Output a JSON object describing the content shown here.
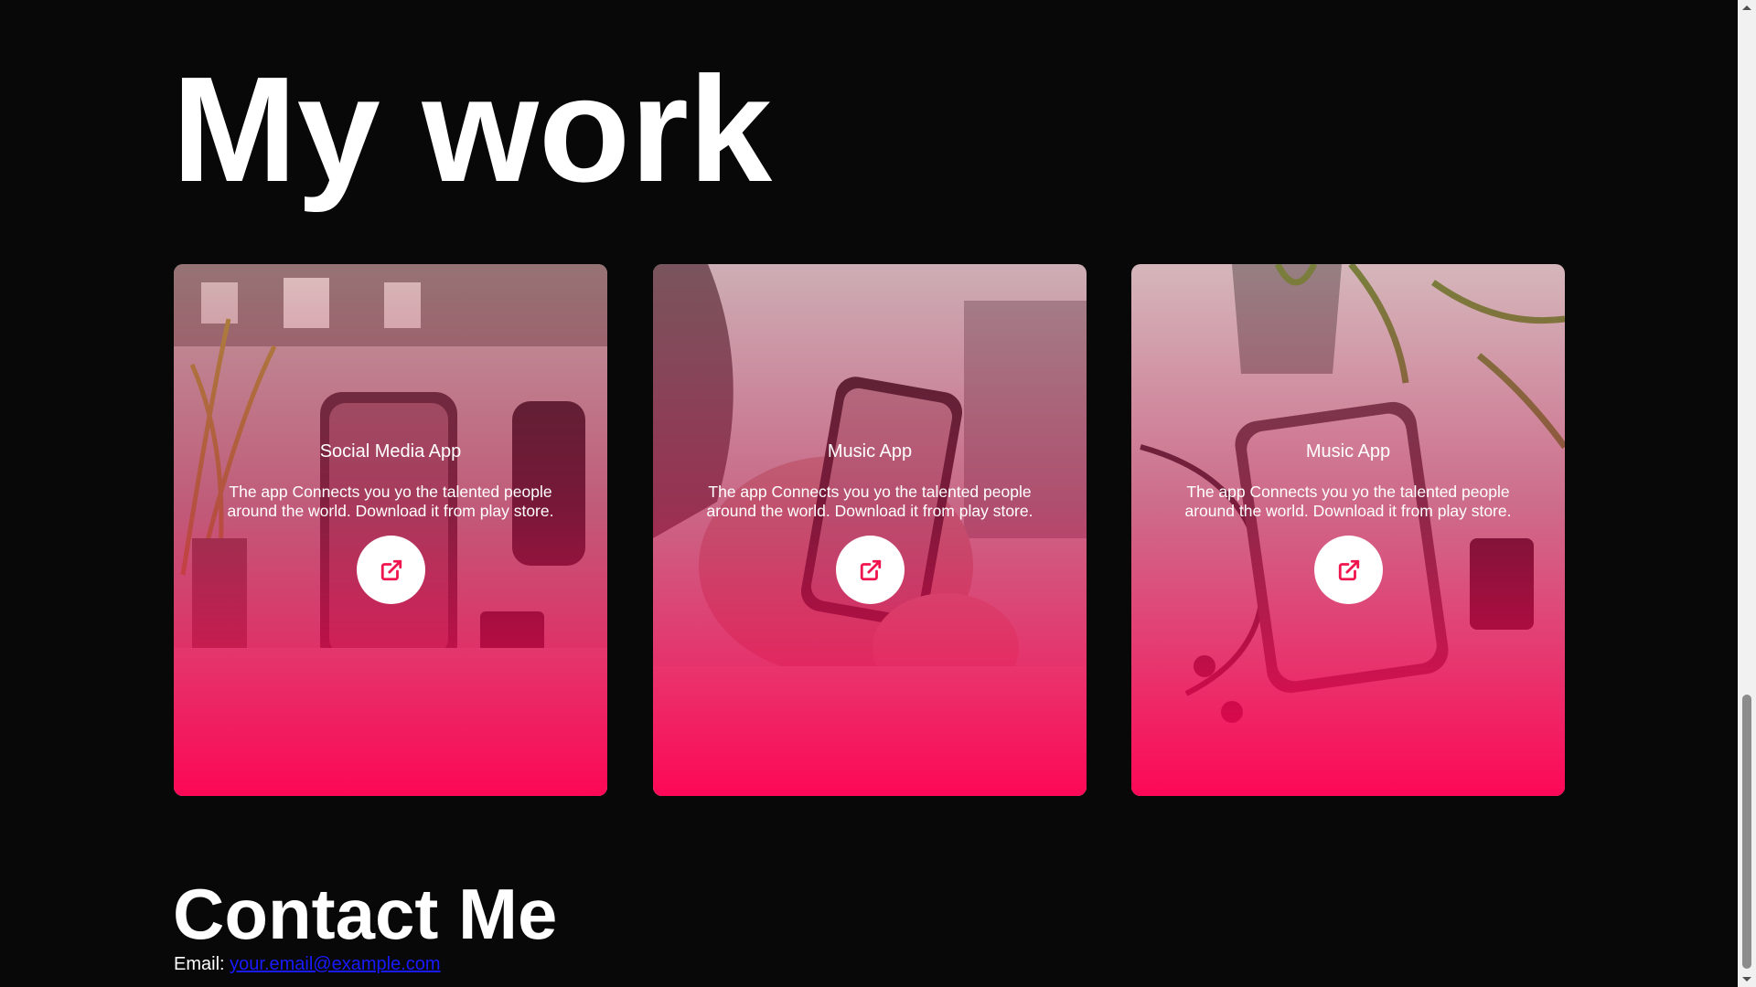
{
  "work": {
    "title": "My work",
    "cards": [
      {
        "title": "Social Media App",
        "description": "The app Connects you yo the talented people around the world. Download it from play store.",
        "link_icon": "external-link-icon"
      },
      {
        "title": "Music App",
        "description": "The app Connects you yo the talented people around the world. Download it from play store.",
        "link_icon": "external-link-icon"
      },
      {
        "title": "Music App",
        "description": "The app Connects you yo the talented people around the world. Download it from play store.",
        "link_icon": "external-link-icon"
      }
    ]
  },
  "contact": {
    "title": "Contact Me",
    "email_label": "Email:",
    "email": "your.email@example.com"
  },
  "colors": {
    "background": "#080808",
    "accent": "#ff0050",
    "text": "#ffffff",
    "link": "#1a1aff"
  }
}
